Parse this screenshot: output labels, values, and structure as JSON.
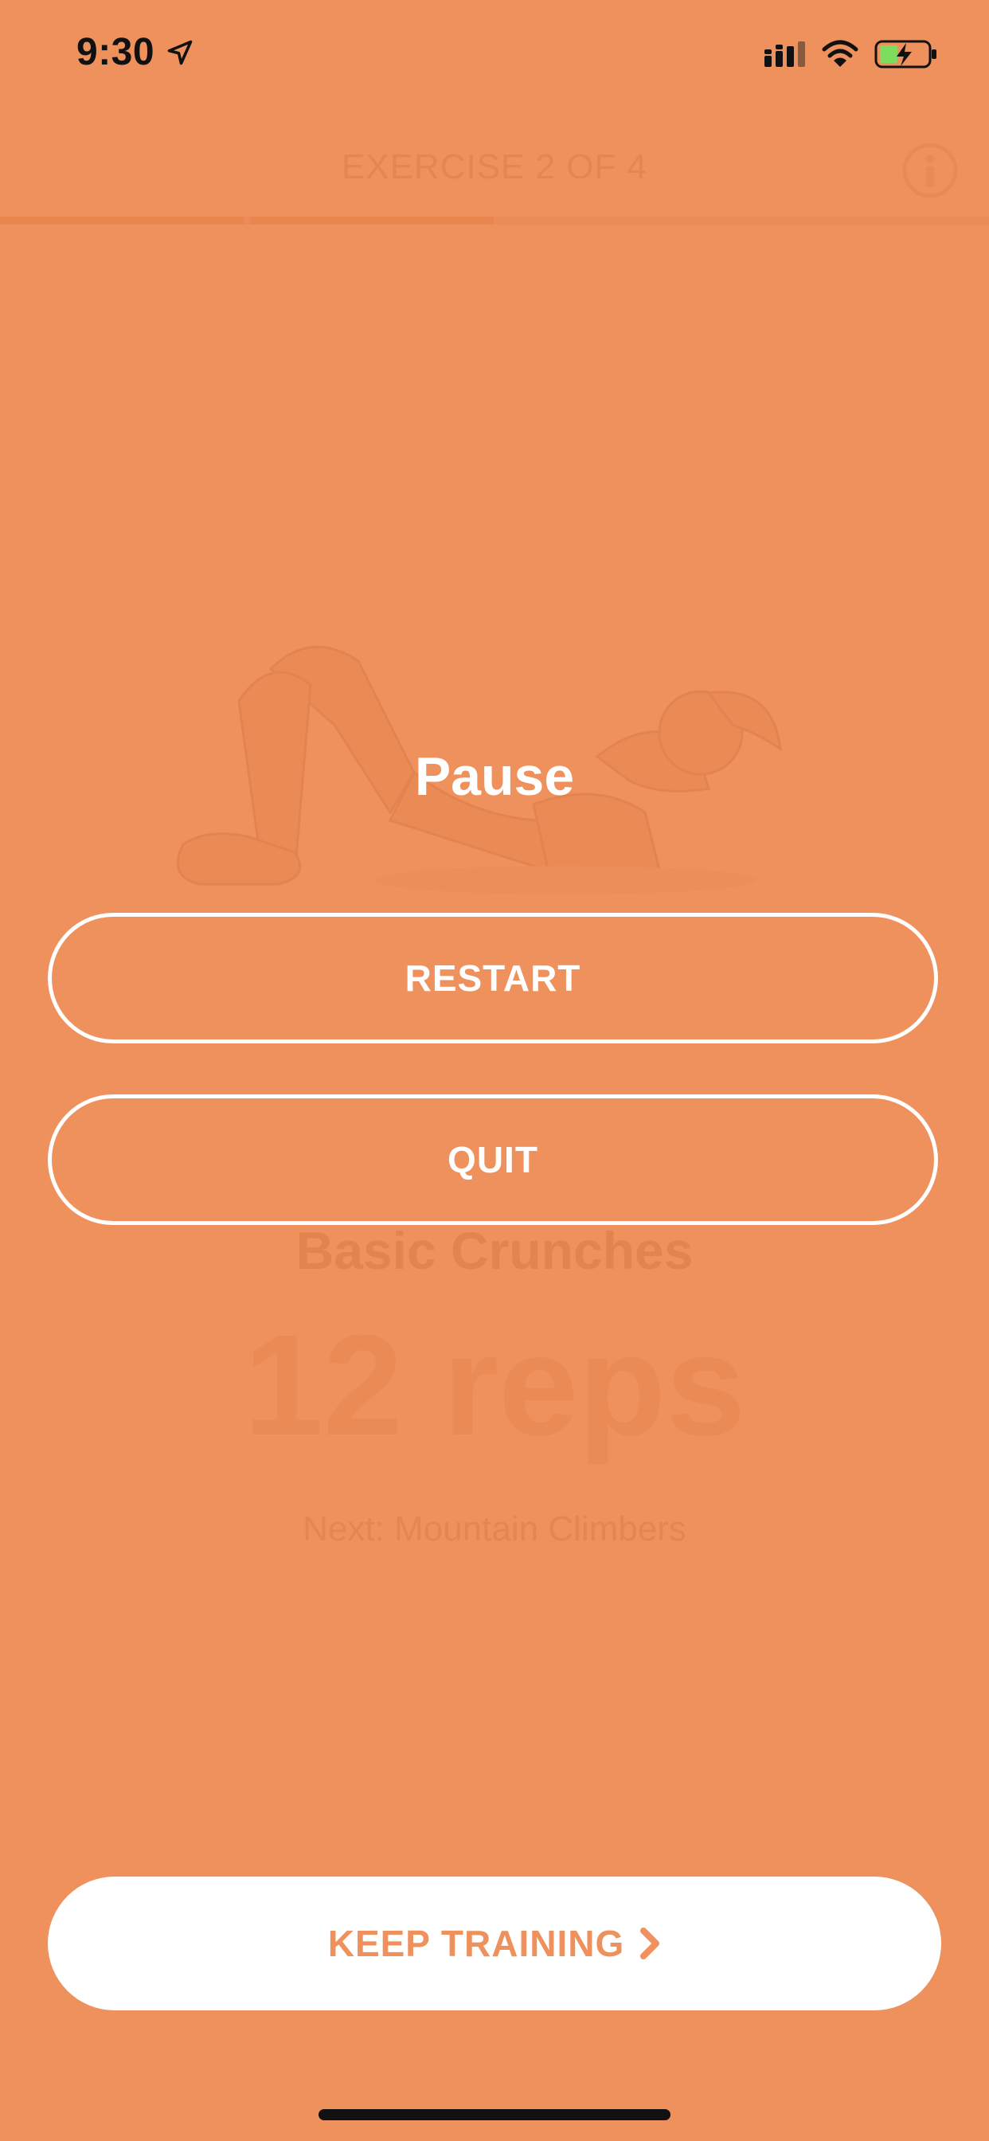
{
  "status_bar": {
    "time": "9:30"
  },
  "header": {
    "title": "EXERCISE 2 OF 4",
    "progress_completed_segments": 2,
    "progress_total_segments": 4
  },
  "exercise": {
    "name": "Basic Crunches",
    "reps": "12 reps",
    "next": "Next: Mountain Climbers"
  },
  "pause_modal": {
    "title": "Pause",
    "restart_label": "RESTART",
    "quit_label": "QUIT"
  },
  "footer": {
    "keep_training_label": "KEEP TRAINING"
  },
  "colors": {
    "background": "#EE915D",
    "text_light": "#FFFFFF",
    "accent": "#EE915D"
  },
  "icons": [
    "location-arrow-icon",
    "cellular-signal-icon",
    "wifi-icon",
    "battery-charging-icon",
    "info-icon",
    "chevron-right-icon"
  ]
}
